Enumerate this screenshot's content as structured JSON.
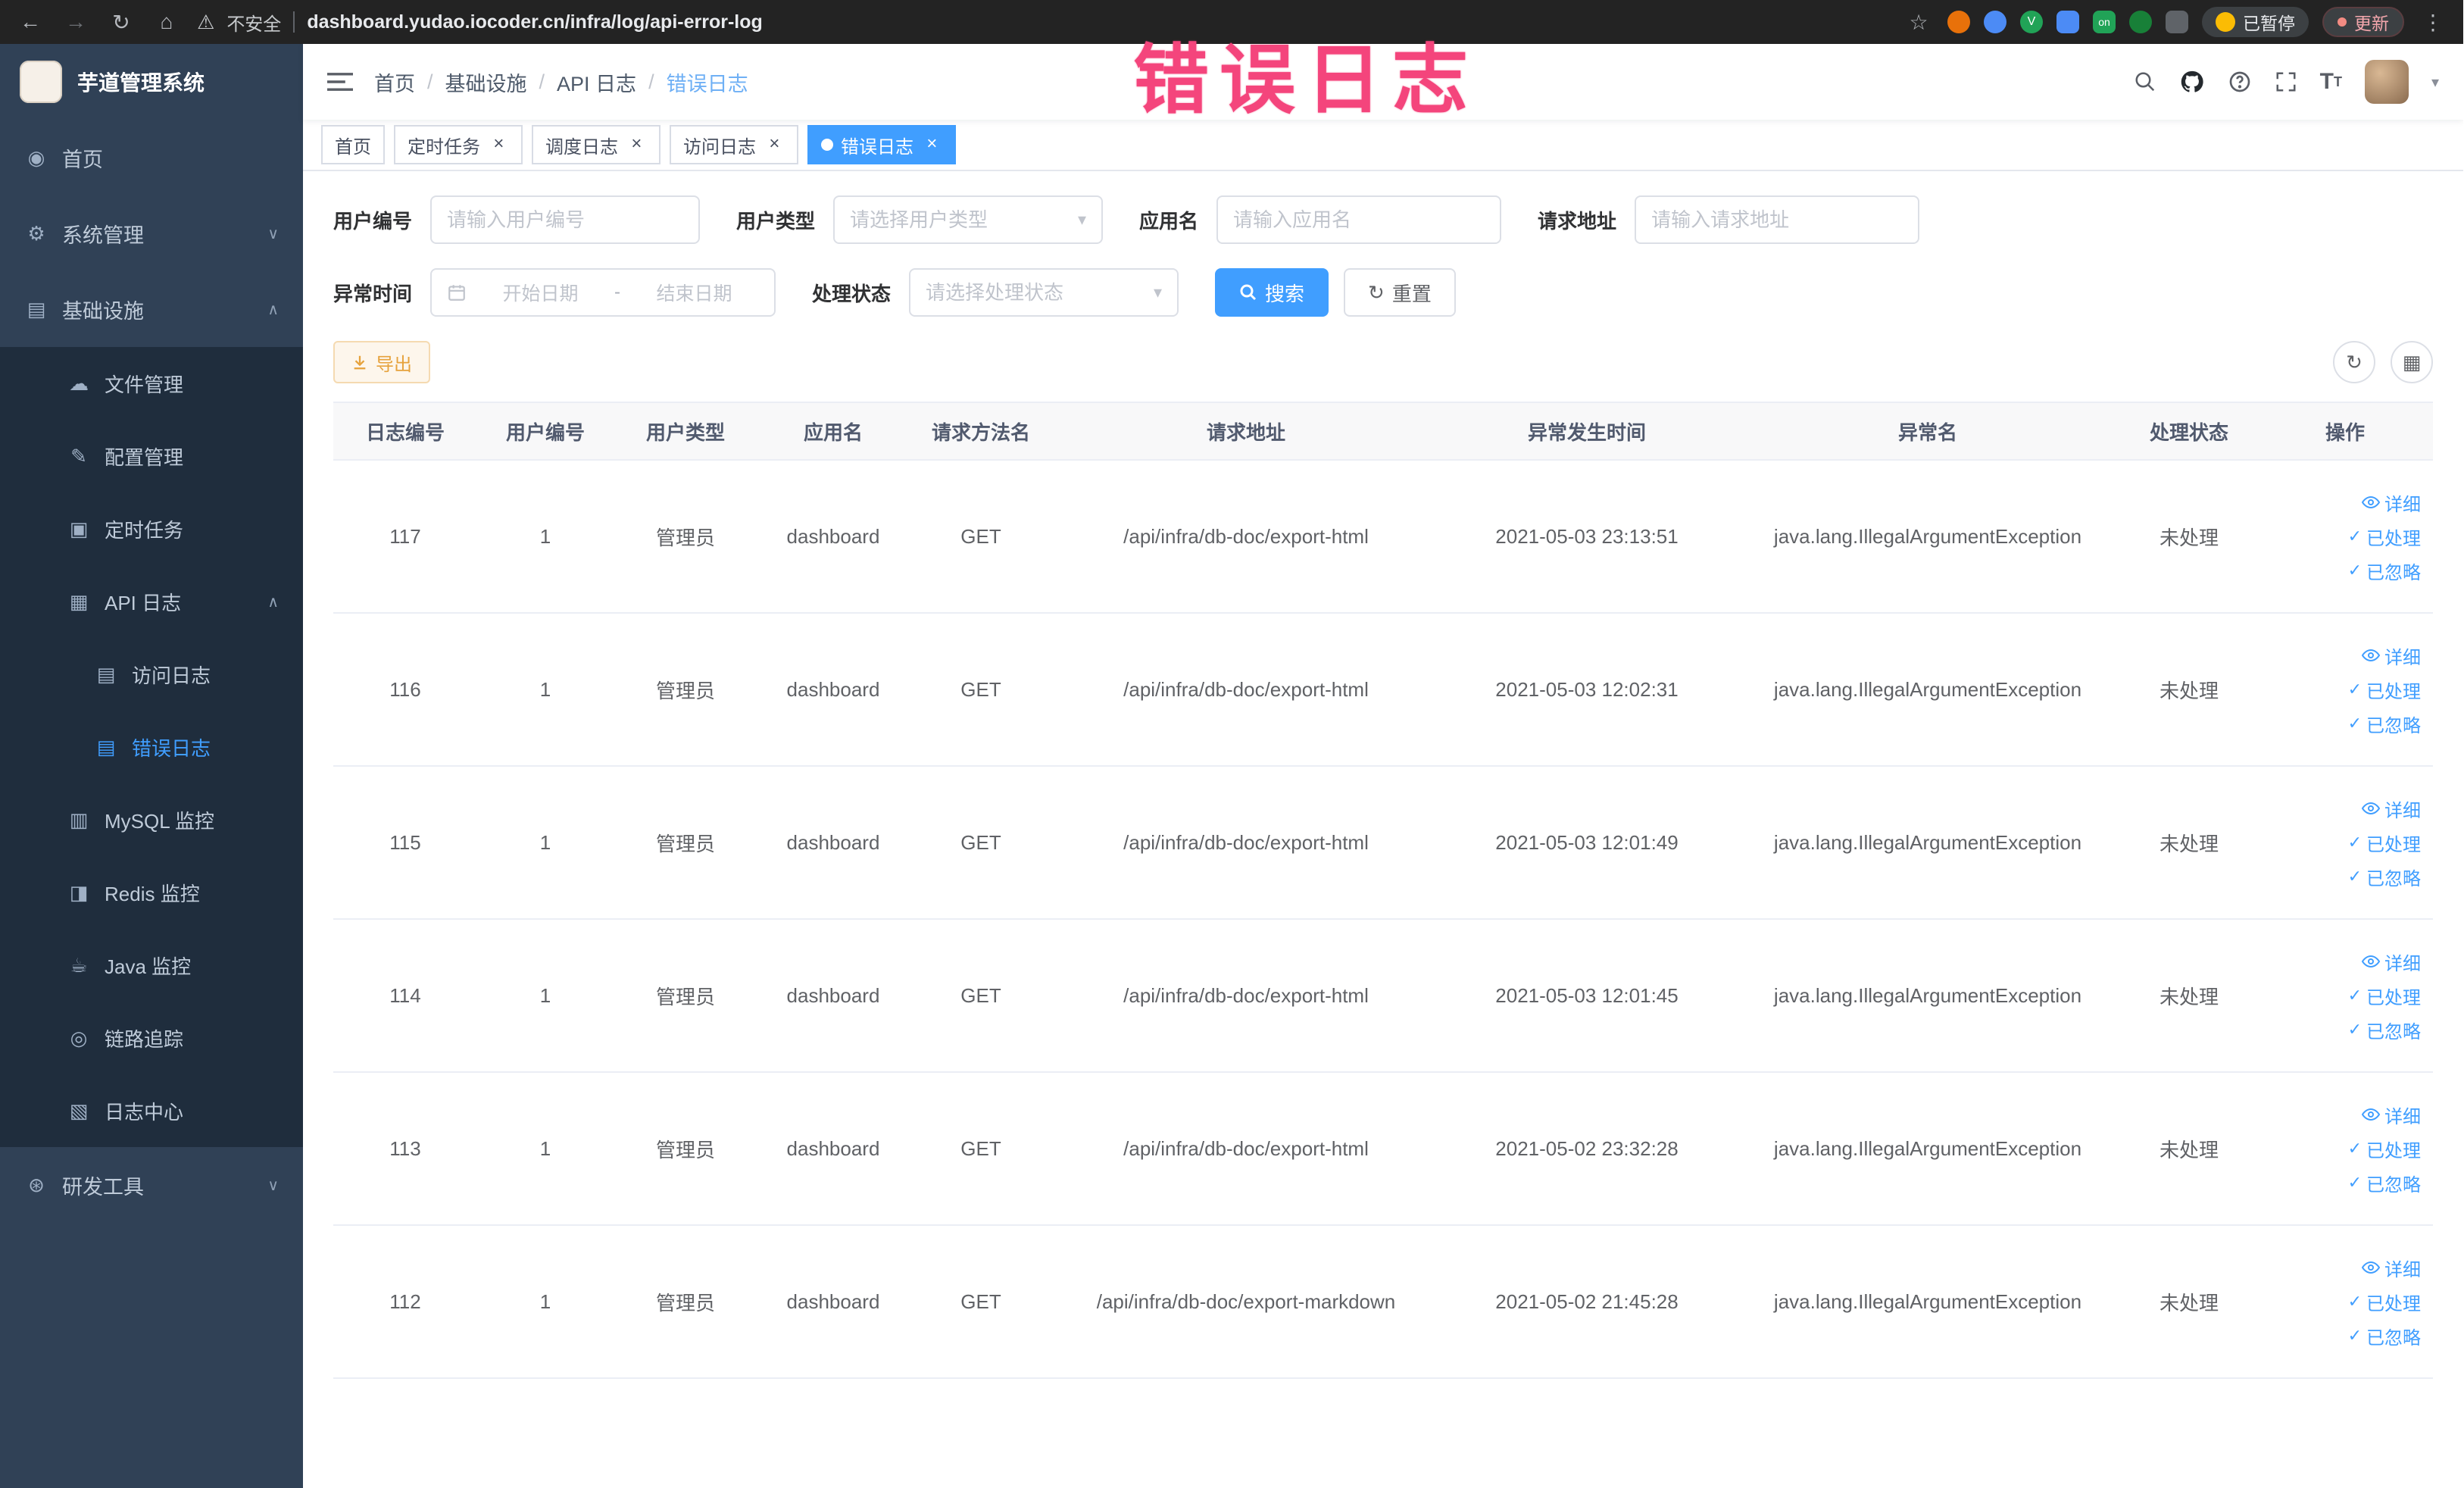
{
  "browser": {
    "security_label": "不安全",
    "url": "dashboard.yudao.iocoder.cn/infra/log/api-error-log",
    "paused_badge": "已暂停",
    "on_badge": "on",
    "update_button": "更新"
  },
  "annotation": {
    "text": "错误日志",
    "color": "#f4457c"
  },
  "colors": {
    "primary": "#409eff",
    "warning": "#e6a23c",
    "sidebar_bg": "#304156",
    "submenu_bg": "#1f2d3d"
  },
  "sidebar": {
    "logo_title": "芋道管理系统",
    "items": [
      {
        "key": "home",
        "label": "首页",
        "icon": "home-icon",
        "depth": 0
      },
      {
        "key": "system-management",
        "label": "系统管理",
        "icon": "gear-icon",
        "depth": 0,
        "chevron": "down"
      },
      {
        "key": "infrastructure",
        "label": "基础设施",
        "icon": "grid-icon",
        "depth": 0,
        "chevron": "up"
      },
      {
        "key": "file-management",
        "label": "文件管理",
        "icon": "cloud-icon",
        "depth": 1,
        "sub": true
      },
      {
        "key": "config-management",
        "label": "配置管理",
        "icon": "edit-icon",
        "depth": 1,
        "sub": true
      },
      {
        "key": "scheduled-tasks",
        "label": "定时任务",
        "icon": "task-icon",
        "depth": 1,
        "sub": true
      },
      {
        "key": "api-logs",
        "label": "API 日志",
        "icon": "api-log-icon",
        "depth": 1,
        "sub": true,
        "chevron": "up"
      },
      {
        "key": "access-log",
        "label": "访问日志",
        "icon": "doc-icon",
        "depth": 2,
        "sub": true
      },
      {
        "key": "error-log",
        "label": "错误日志",
        "icon": "doc-icon",
        "depth": 2,
        "sub": true,
        "active": true
      },
      {
        "key": "mysql-monitor",
        "label": "MySQL 监控",
        "icon": "monitor-icon",
        "depth": 1,
        "sub": true
      },
      {
        "key": "redis-monitor",
        "label": "Redis 监控",
        "icon": "redis-icon",
        "depth": 1,
        "sub": true
      },
      {
        "key": "java-monitor",
        "label": "Java 监控",
        "icon": "java-icon",
        "depth": 1,
        "sub": true
      },
      {
        "key": "trace",
        "label": "链路追踪",
        "icon": "trace-icon",
        "depth": 1,
        "sub": true
      },
      {
        "key": "log-center",
        "label": "日志中心",
        "icon": "log-center-icon",
        "depth": 1,
        "sub": true
      },
      {
        "key": "dev-tools",
        "label": "研发工具",
        "icon": "tool-icon",
        "depth": 0,
        "chevron": "down"
      }
    ]
  },
  "header": {
    "breadcrumb": [
      "首页",
      "基础设施",
      "API 日志",
      "错误日志"
    ]
  },
  "tabs": [
    {
      "key": "home",
      "label": "首页",
      "closable": false,
      "active": false
    },
    {
      "key": "scheduled-tasks",
      "label": "定时任务",
      "closable": true,
      "active": false
    },
    {
      "key": "schedule-log",
      "label": "调度日志",
      "closable": true,
      "active": false
    },
    {
      "key": "access-log",
      "label": "访问日志",
      "closable": true,
      "active": false
    },
    {
      "key": "error-log",
      "label": "错误日志",
      "closable": true,
      "active": true
    }
  ],
  "filters": {
    "user_id": {
      "label": "用户编号",
      "placeholder": "请输入用户编号"
    },
    "user_type": {
      "label": "用户类型",
      "placeholder": "请选择用户类型"
    },
    "app_name": {
      "label": "应用名",
      "placeholder": "请输入应用名"
    },
    "request_url": {
      "label": "请求地址",
      "placeholder": "请输入请求地址"
    },
    "exception_time": {
      "label": "异常时间",
      "start_placeholder": "开始日期",
      "separator": "-",
      "end_placeholder": "结束日期"
    },
    "process_status": {
      "label": "处理状态",
      "placeholder": "请选择处理状态"
    },
    "search_label": "搜索",
    "reset_label": "重置"
  },
  "toolbar": {
    "export_label": "导出"
  },
  "table": {
    "columns": [
      "日志编号",
      "用户编号",
      "用户类型",
      "应用名",
      "请求方法名",
      "请求地址",
      "异常发生时间",
      "异常名",
      "处理状态",
      "操作"
    ],
    "row_actions": [
      "详细",
      "已处理",
      "已忽略"
    ],
    "rows": [
      {
        "id": "117",
        "user_id": "1",
        "user_type": "管理员",
        "app": "dashboard",
        "method": "GET",
        "url": "/api/infra/db-doc/export-html",
        "time": "2021-05-03 23:13:51",
        "exception": "java.lang.IllegalArgumentException",
        "status": "未处理"
      },
      {
        "id": "116",
        "user_id": "1",
        "user_type": "管理员",
        "app": "dashboard",
        "method": "GET",
        "url": "/api/infra/db-doc/export-html",
        "time": "2021-05-03 12:02:31",
        "exception": "java.lang.IllegalArgumentException",
        "status": "未处理"
      },
      {
        "id": "115",
        "user_id": "1",
        "user_type": "管理员",
        "app": "dashboard",
        "method": "GET",
        "url": "/api/infra/db-doc/export-html",
        "time": "2021-05-03 12:01:49",
        "exception": "java.lang.IllegalArgumentException",
        "status": "未处理"
      },
      {
        "id": "114",
        "user_id": "1",
        "user_type": "管理员",
        "app": "dashboard",
        "method": "GET",
        "url": "/api/infra/db-doc/export-html",
        "time": "2021-05-03 12:01:45",
        "exception": "java.lang.IllegalArgumentException",
        "status": "未处理"
      },
      {
        "id": "113",
        "user_id": "1",
        "user_type": "管理员",
        "app": "dashboard",
        "method": "GET",
        "url": "/api/infra/db-doc/export-html",
        "time": "2021-05-02 23:32:28",
        "exception": "java.lang.IllegalArgumentException",
        "status": "未处理"
      },
      {
        "id": "112",
        "user_id": "1",
        "user_type": "管理员",
        "app": "dashboard",
        "method": "GET",
        "url": "/api/infra/db-doc/export-markdown",
        "time": "2021-05-02 21:45:28",
        "exception": "java.lang.IllegalArgumentException",
        "status": "未处理"
      }
    ]
  }
}
